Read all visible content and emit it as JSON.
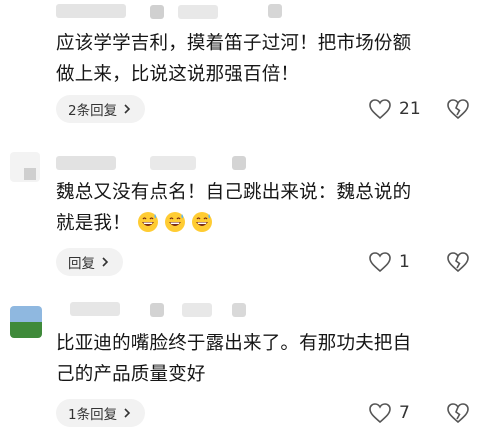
{
  "comments": [
    {
      "lines": [
        "应该学学吉利，摸着笛子过河！把市场份额",
        "做上来，比说这说那强百倍！"
      ],
      "reply_label": "2条回复",
      "like_count": "21"
    },
    {
      "lines": [
        "魏总又没有点名！自己跳出来说：魏总说的",
        "就是我！"
      ],
      "emojis": [
        "grinning-sweat-emoji",
        "grinning-sweat-emoji",
        "grinning-sweat-emoji"
      ],
      "reply_label": "回复",
      "like_count": "1"
    },
    {
      "lines": [
        "比亚迪的嘴脸终于露出来了。有那功夫把自",
        "己的产品质量变好"
      ],
      "reply_label": "1条回复",
      "like_count": "7"
    }
  ],
  "icons": [
    "heart-outline-icon",
    "broken-heart-icon",
    "chevron-right-icon"
  ],
  "colors": {
    "pill_bg": "#f2f2f2",
    "text": "#161616",
    "icon": "#555555"
  }
}
